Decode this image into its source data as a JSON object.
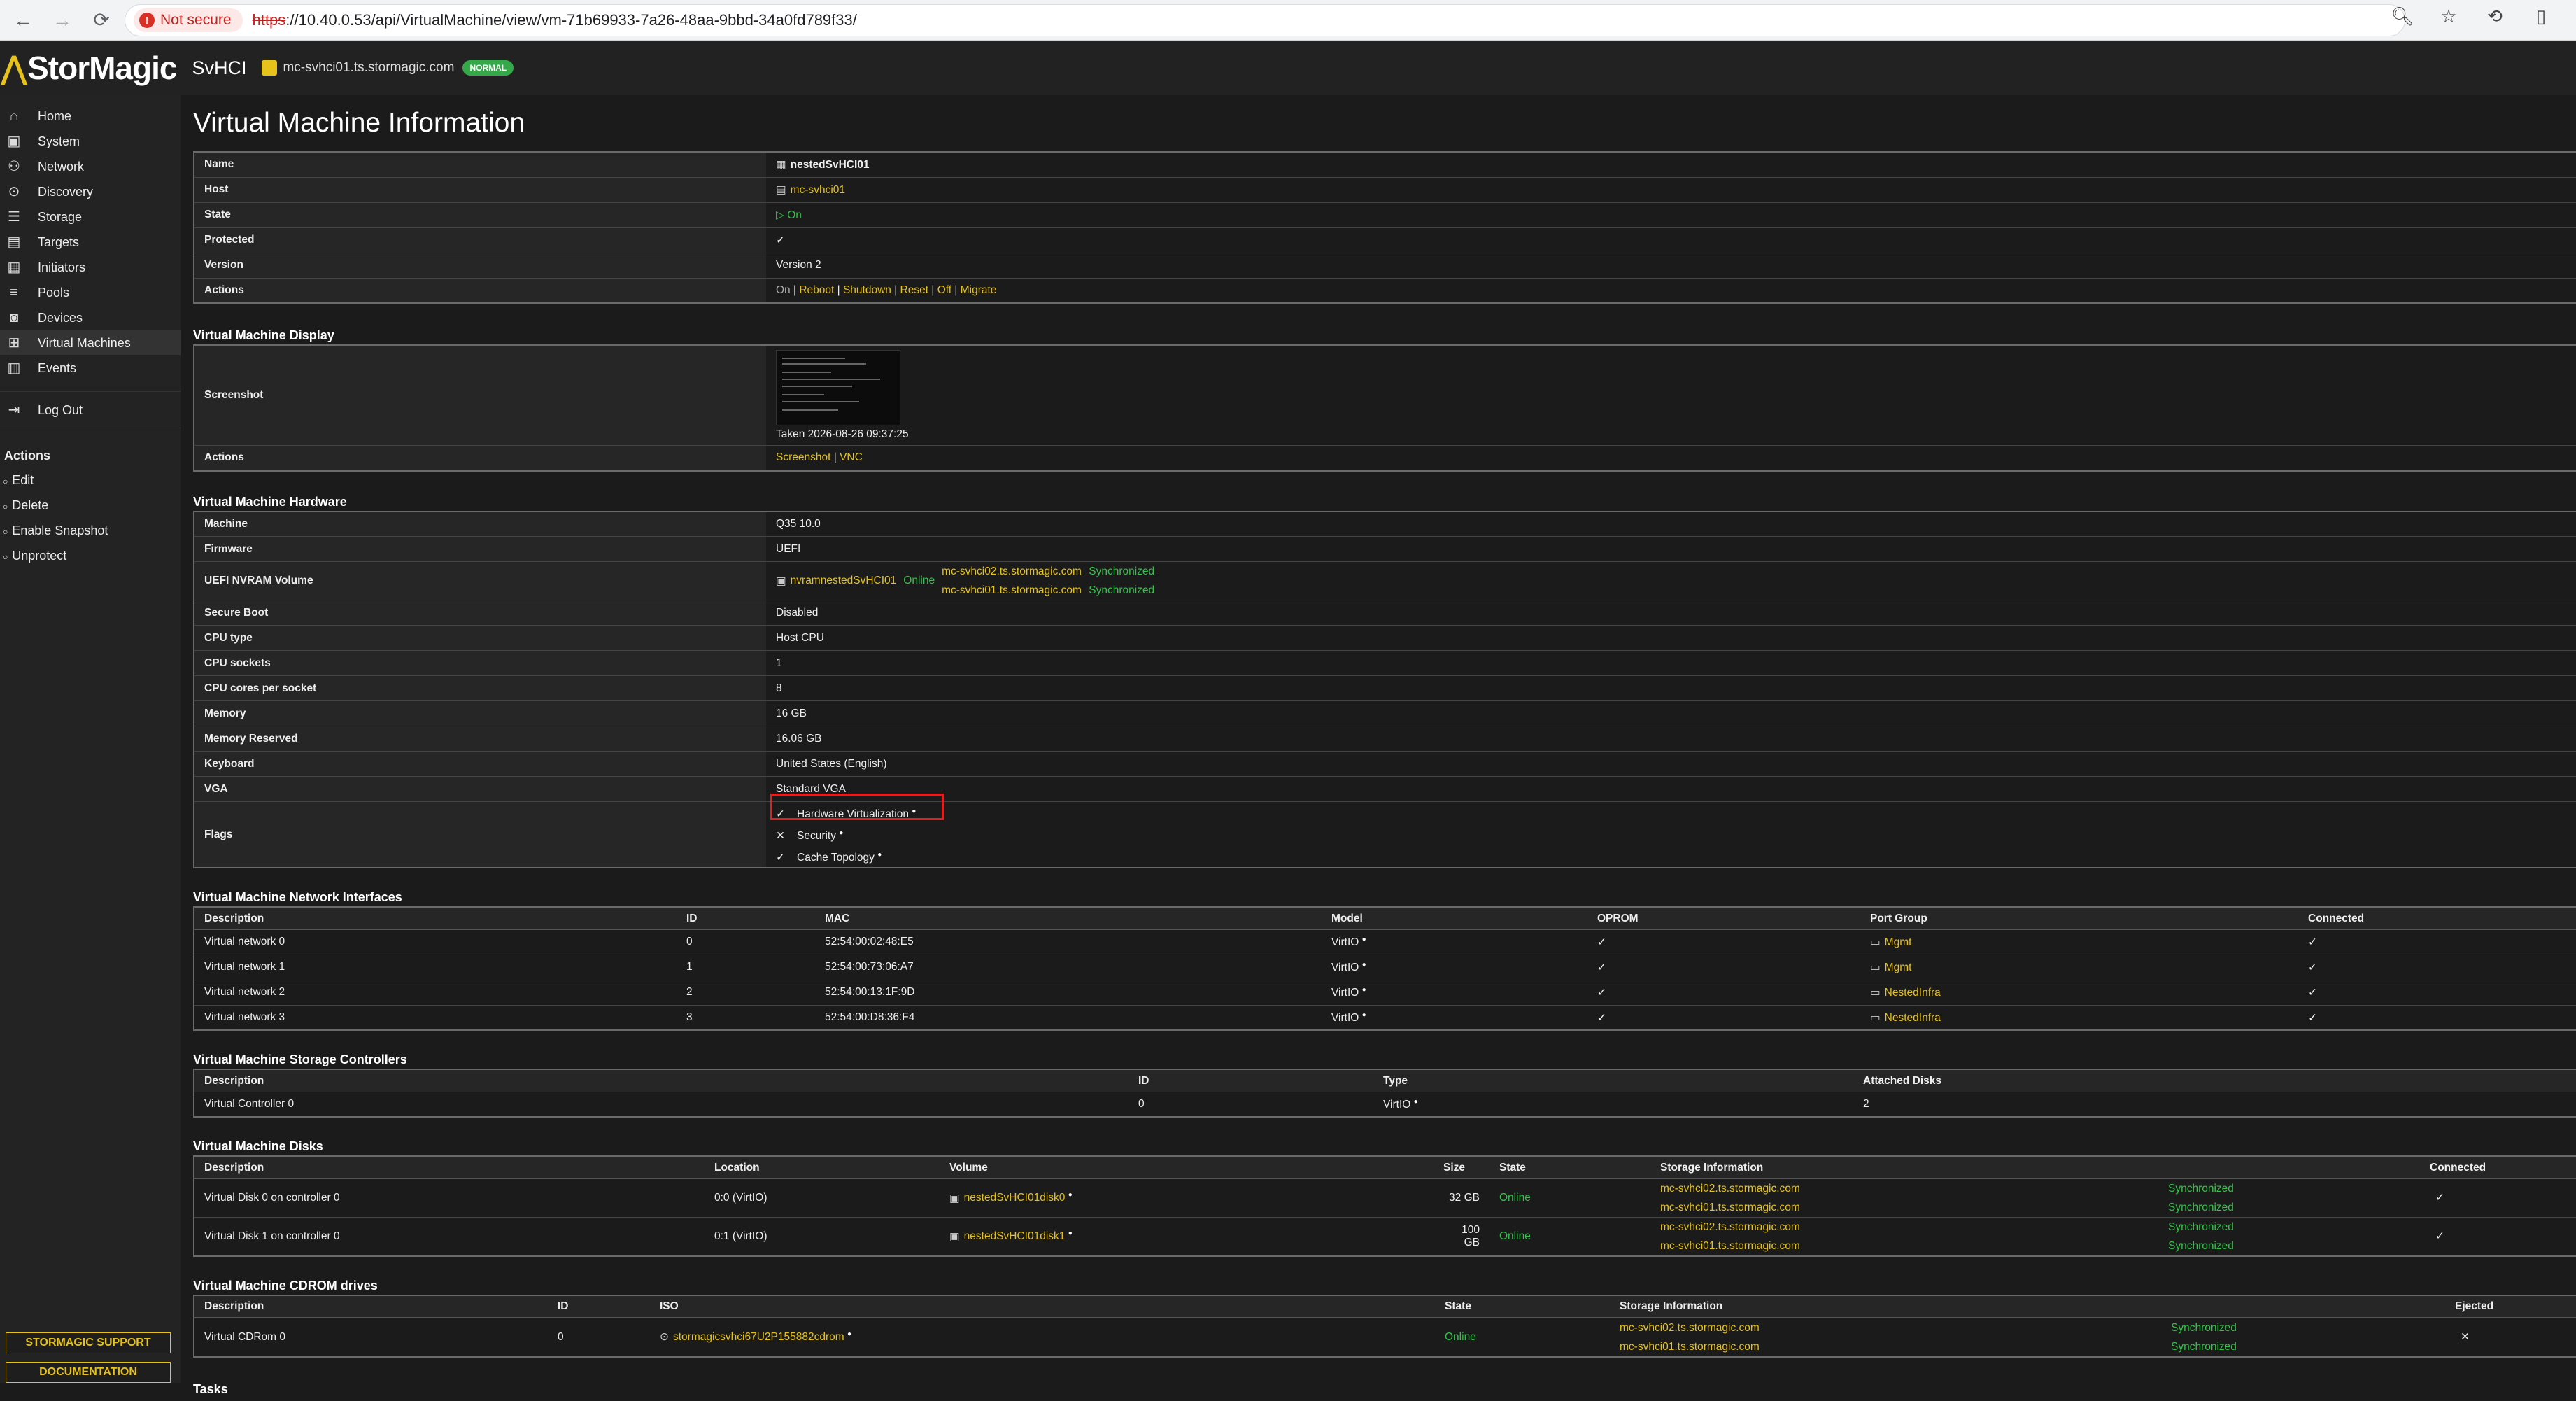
{
  "browser": {
    "not_secure": "Not secure",
    "url_scheme": "https",
    "url_rest": "://10.40.0.53/api/VirtualMachine/view/vm-71b69933-7a26-48aa-9bbd-34a0fd789f33/"
  },
  "app": {
    "brand": "StorMagic",
    "product": "SvHCI",
    "host": "mc-svhci01.ts.stormagic.com",
    "status": "NORMAL"
  },
  "sidebar": {
    "items": [
      {
        "label": "Home",
        "icon": "home-icon"
      },
      {
        "label": "System",
        "icon": "system-icon"
      },
      {
        "label": "Network",
        "icon": "network-icon"
      },
      {
        "label": "Discovery",
        "icon": "discovery-icon"
      },
      {
        "label": "Storage",
        "icon": "storage-icon"
      },
      {
        "label": "Targets",
        "icon": "targets-icon"
      },
      {
        "label": "Initiators",
        "icon": "initiators-icon"
      },
      {
        "label": "Pools",
        "icon": "pools-icon"
      },
      {
        "label": "Devices",
        "icon": "devices-icon"
      },
      {
        "label": "Virtual Machines",
        "icon": "vm-icon"
      },
      {
        "label": "Events",
        "icon": "events-icon"
      },
      {
        "label": "Log Out",
        "icon": "logout-icon"
      }
    ],
    "actions_title": "Actions",
    "actions": [
      "Edit",
      "Delete",
      "Enable Snapshot",
      "Unprotect"
    ],
    "support": "STORMAGIC SUPPORT",
    "docs": "DOCUMENTATION"
  },
  "page": {
    "title": "Virtual Machine Information",
    "info": {
      "name_k": "Name",
      "name_v": "nestedSvHCI01",
      "host_k": "Host",
      "host_v": "mc-svhci01",
      "state_k": "State",
      "state_v": "On",
      "protected_k": "Protected",
      "protected_v": "✓",
      "version_k": "Version",
      "version_v": "Version 2",
      "actions_k": "Actions",
      "actions": [
        "On",
        "Reboot",
        "Shutdown",
        "Reset",
        "Off",
        "Migrate"
      ]
    },
    "display": {
      "title": "Virtual Machine Display",
      "screenshot_k": "Screenshot",
      "taken": "Taken 2026-08-26 09:37:25",
      "actions_k": "Actions",
      "actions": [
        "Screenshot",
        "VNC"
      ]
    },
    "hardware": {
      "title": "Virtual Machine Hardware",
      "machine_k": "Machine",
      "machine_v": "Q35 10.0",
      "firmware_k": "Firmware",
      "firmware_v": "UEFI",
      "nvram_k": "UEFI NVRAM Volume",
      "nvram_v": "nvramnestedSvHCI01",
      "nvram_state": "Online",
      "nvram_host1": "mc-svhci02.ts.stormagic.com",
      "nvram_sync1": "Synchronized",
      "nvram_host2": "mc-svhci01.ts.stormagic.com",
      "nvram_sync2": "Synchronized",
      "secure_k": "Secure Boot",
      "secure_v": "Disabled",
      "cputype_k": "CPU type",
      "cputype_v": "Host CPU",
      "sockets_k": "CPU sockets",
      "sockets_v": "1",
      "cores_k": "CPU cores per socket",
      "cores_v": "8",
      "memory_k": "Memory",
      "memory_v": "16 GB",
      "memres_k": "Memory Reserved",
      "memres_v": "16.06 GB",
      "keyboard_k": "Keyboard",
      "keyboard_v": "United States (English)",
      "vga_k": "VGA",
      "vga_v": "Standard VGA",
      "flags_k": "Flags",
      "flags": [
        {
          "mark": "✓",
          "label": "Hardware Virtualization"
        },
        {
          "mark": "✕",
          "label": "Security"
        },
        {
          "mark": "✓",
          "label": "Cache Topology"
        }
      ]
    },
    "nics": {
      "title": "Virtual Machine Network Interfaces",
      "headers": [
        "Description",
        "ID",
        "MAC",
        "Model",
        "OPROM",
        "Port Group",
        "Connected"
      ],
      "rows": [
        [
          "Virtual network 0",
          "0",
          "52:54:00:02:48:E5",
          "VirtIO",
          "✓",
          "Mgmt",
          "✓"
        ],
        [
          "Virtual network 1",
          "1",
          "52:54:00:73:06:A7",
          "VirtIO",
          "✓",
          "Mgmt",
          "✓"
        ],
        [
          "Virtual network 2",
          "2",
          "52:54:00:13:1F:9D",
          "VirtIO",
          "✓",
          "NestedInfra",
          "✓"
        ],
        [
          "Virtual network 3",
          "3",
          "52:54:00:D8:36:F4",
          "VirtIO",
          "✓",
          "NestedInfra",
          "✓"
        ]
      ]
    },
    "controllers": {
      "title": "Virtual Machine Storage Controllers",
      "headers": [
        "Description",
        "ID",
        "Type",
        "Attached Disks"
      ],
      "rows": [
        [
          "Virtual Controller 0",
          "0",
          "VirtIO",
          "2"
        ]
      ]
    },
    "disks": {
      "title": "Virtual Machine Disks",
      "headers": [
        "Description",
        "Location",
        "Volume",
        "Size",
        "State",
        "Storage Information",
        "",
        "Connected"
      ],
      "rows": [
        {
          "desc": "Virtual Disk 0 on controller 0",
          "loc": "0:0 (VirtIO)",
          "vol": "nestedSvHCI01disk0",
          "size": "32 GB",
          "state": "Online",
          "h1": "mc-svhci02.ts.stormagic.com",
          "h2": "mc-svhci01.ts.stormagic.com",
          "s1": "Synchronized",
          "s2": "Synchronized",
          "conn": "✓"
        },
        {
          "desc": "Virtual Disk 1 on controller 0",
          "loc": "0:1 (VirtIO)",
          "vol": "nestedSvHCI01disk1",
          "size": "100 GB",
          "state": "Online",
          "h1": "mc-svhci02.ts.stormagic.com",
          "h2": "mc-svhci01.ts.stormagic.com",
          "s1": "Synchronized",
          "s2": "Synchronized",
          "conn": "✓"
        }
      ]
    },
    "cdrom": {
      "title": "Virtual Machine CDROM drives",
      "headers": [
        "Description",
        "ID",
        "ISO",
        "State",
        "Storage Information",
        "",
        "Ejected"
      ],
      "row": {
        "desc": "Virtual CDRom 0",
        "id": "0",
        "iso": "stormagicsvhci67U2P155882cdrom",
        "state": "Online",
        "h1": "mc-svhci02.ts.stormagic.com",
        "h2": "mc-svhci01.ts.stormagic.com",
        "s1": "Synchronized",
        "s2": "Synchronized",
        "ejected": "✕"
      }
    },
    "tasks_title": "Tasks"
  }
}
